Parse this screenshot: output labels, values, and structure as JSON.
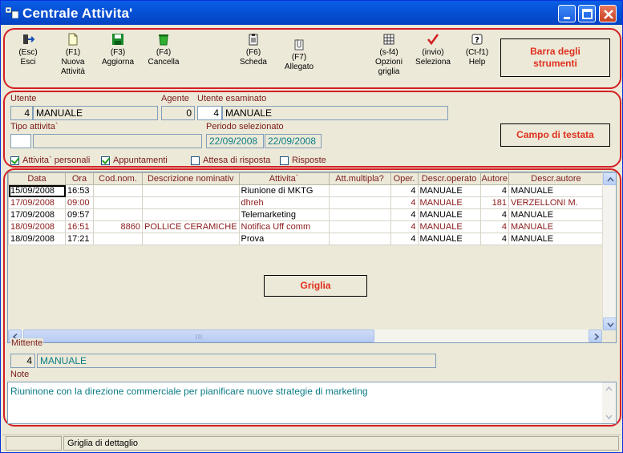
{
  "window": {
    "title": "Centrale Attivita'"
  },
  "toolbar": {
    "tools": [
      {
        "key": "(Esc)",
        "label": "Esci"
      },
      {
        "key": "(F1)",
        "label": "Nuova Attività"
      },
      {
        "key": "(F3)",
        "label": "Aggiorna"
      },
      {
        "key": "(F4)",
        "label": "Cancella"
      },
      {
        "key": "(F6)",
        "label": "Scheda"
      },
      {
        "key": "(F7)",
        "label": "Allegato"
      },
      {
        "key": "(s-f4)",
        "label": "Opzioni griglia"
      },
      {
        "key": "(invio)",
        "label": "Seleziona"
      },
      {
        "key": "(Ct-f1)",
        "label": "Help"
      }
    ],
    "callout": "Barra degli strumenti"
  },
  "header": {
    "utente_label": "Utente",
    "utente_code": "4",
    "utente_name": "MANUALE",
    "agente_label": "Agente",
    "agente_value": "0",
    "esaminato_label": "Utente esaminato",
    "esaminato_code": "4",
    "esaminato_name": "MANUALE",
    "tipo_label": "Tipo attivita`",
    "tipo_code": "",
    "tipo_desc": "",
    "periodo_label": "Periodo selezionato",
    "periodo_from": "22/09/2008",
    "periodo_to": "22/09/2008",
    "checks": [
      {
        "label": "Attivita` personali",
        "checked": true
      },
      {
        "label": "Appuntamenti",
        "checked": true
      },
      {
        "label": "Attesa di risposta",
        "checked": false
      },
      {
        "label": "Risposte",
        "checked": false
      }
    ],
    "callout": "Campo di testata"
  },
  "grid": {
    "columns": [
      "Data",
      "Ora",
      "Cod.nom.",
      "Descrizione nominativ",
      "Attivita`",
      "Att.multipla?",
      "Oper.",
      "Descr.operato",
      "Autore",
      "Descr.autore"
    ],
    "rows": [
      {
        "red": false,
        "cells": [
          "15/09/2008",
          "16:53",
          "",
          "",
          "Riunione di MKTG",
          "",
          "4",
          "MANUALE",
          "4",
          "MANUALE"
        ]
      },
      {
        "red": true,
        "cells": [
          "17/09/2008",
          "09:00",
          "",
          "",
          "dhreh",
          "",
          "4",
          "MANUALE",
          "181",
          "VERZELLONI M."
        ]
      },
      {
        "red": false,
        "cells": [
          "17/09/2008",
          "09:57",
          "",
          "",
          "Telemarketing",
          "",
          "4",
          "MANUALE",
          "4",
          "MANUALE"
        ]
      },
      {
        "red": true,
        "cells": [
          "18/09/2008",
          "16:51",
          "8860",
          "POLLICE CERAMICHE",
          "Notifica Uff comm",
          "",
          "4",
          "MANUALE",
          "4",
          "MANUALE"
        ]
      },
      {
        "red": false,
        "cells": [
          "18/09/2008",
          "17:21",
          "",
          "",
          "Prova",
          "",
          "4",
          "MANUALE",
          "4",
          "MANUALE"
        ]
      }
    ],
    "callout": "Griglia"
  },
  "footer": {
    "mittente_label": "Mittente",
    "mittente_code": "4",
    "mittente_name": "MANUALE",
    "note_label": "Note",
    "note_text": "Riuninone con la direzione commerciale per pianificare nuove strategie di marketing"
  },
  "status": {
    "cell1": "",
    "cell2": "Griglia di dettaglio"
  }
}
